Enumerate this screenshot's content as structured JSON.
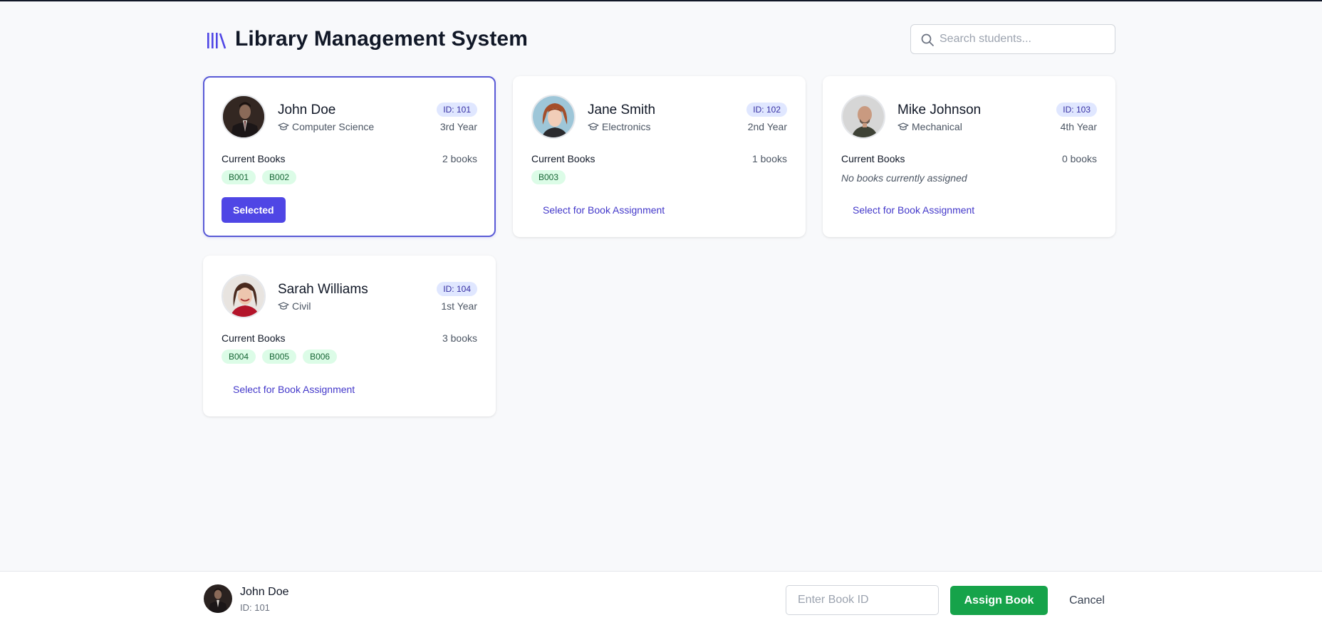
{
  "app": {
    "title": "Library Management System",
    "logo_icon": "library-books-icon",
    "accent_color": "#4f46e5"
  },
  "search": {
    "placeholder": "Search students...",
    "value": "",
    "icon": "search-icon"
  },
  "students": [
    {
      "name": "John Doe",
      "id_label": "ID: 101",
      "department": "Computer Science",
      "year": "3rd Year",
      "books_label": "Current Books",
      "books_count": "2 books",
      "books": [
        "B001",
        "B002"
      ],
      "no_books_text": "",
      "action_label": "Selected",
      "selected": true,
      "avatar_icon": "avatar-man-suit"
    },
    {
      "name": "Jane Smith",
      "id_label": "ID: 102",
      "department": "Electronics",
      "year": "2nd Year",
      "books_label": "Current Books",
      "books_count": "1 books",
      "books": [
        "B003"
      ],
      "no_books_text": "",
      "action_label": "Select for Book Assignment",
      "selected": false,
      "avatar_icon": "avatar-woman-red-hair"
    },
    {
      "name": "Mike Johnson",
      "id_label": "ID: 103",
      "department": "Mechanical",
      "year": "4th Year",
      "books_label": "Current Books",
      "books_count": "0 books",
      "books": [],
      "no_books_text": "No books currently assigned",
      "action_label": "Select for Book Assignment",
      "selected": false,
      "avatar_icon": "avatar-bald-man"
    },
    {
      "name": "Sarah Williams",
      "id_label": "ID: 104",
      "department": "Civil",
      "year": "1st Year",
      "books_label": "Current Books",
      "books_count": "3 books",
      "books": [
        "B004",
        "B005",
        "B006"
      ],
      "no_books_text": "",
      "action_label": "Select for Book Assignment",
      "selected": false,
      "avatar_icon": "avatar-woman-red-top"
    }
  ],
  "footer": {
    "selected_name": "John Doe",
    "selected_id": "ID: 101",
    "book_input_placeholder": "Enter Book ID",
    "book_input_value": "",
    "assign_label": "Assign Book",
    "cancel_label": "Cancel",
    "assign_color": "#16a34a"
  }
}
